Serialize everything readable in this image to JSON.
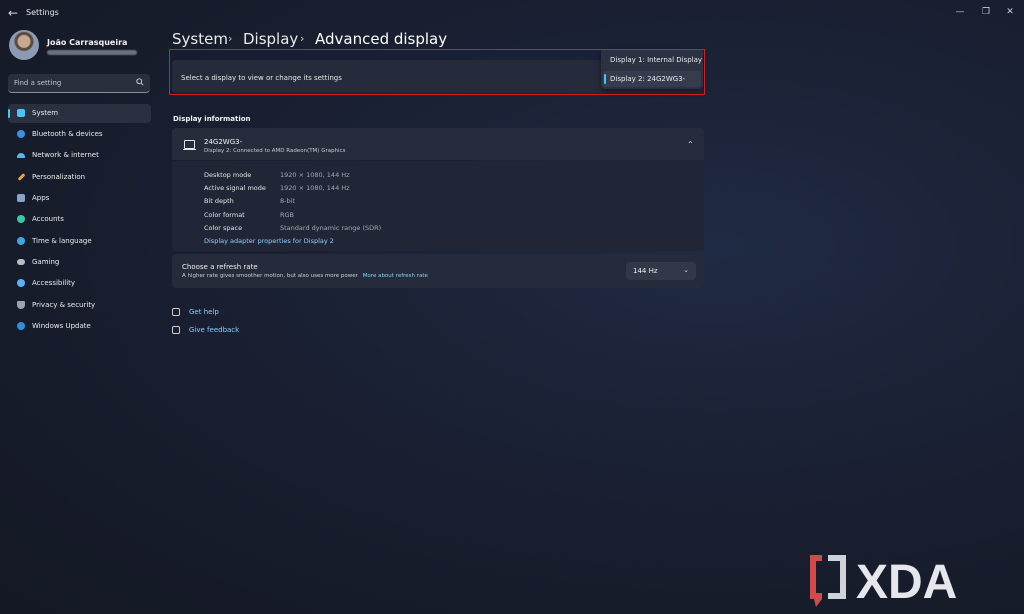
{
  "window": {
    "title": "Settings"
  },
  "profile": {
    "name": "João Carrasqueira"
  },
  "search": {
    "placeholder": "Find a setting"
  },
  "sidebar": {
    "items": [
      {
        "label": "System",
        "icon": "system-icon",
        "color": "#4cc2ff",
        "selected": true
      },
      {
        "label": "Bluetooth & devices",
        "icon": "bluetooth-icon",
        "color": "#3a8ee6"
      },
      {
        "label": "Network & internet",
        "icon": "wifi-icon",
        "color": "#5ab4f0"
      },
      {
        "label": "Personalization",
        "icon": "brush-icon",
        "color": "#e2a24b"
      },
      {
        "label": "Apps",
        "icon": "apps-icon",
        "color": "#8aa4c8"
      },
      {
        "label": "Accounts",
        "icon": "person-icon",
        "color": "#41c6a5"
      },
      {
        "label": "Time & language",
        "icon": "globe-icon",
        "color": "#3fa7e0"
      },
      {
        "label": "Gaming",
        "icon": "controller-icon",
        "color": "#b6bcc8"
      },
      {
        "label": "Accessibility",
        "icon": "accessibility-icon",
        "color": "#5fb0f5"
      },
      {
        "label": "Privacy & security",
        "icon": "shield-icon",
        "color": "#9aa3b2"
      },
      {
        "label": "Windows Update",
        "icon": "update-icon",
        "color": "#2e8fe0"
      }
    ]
  },
  "breadcrumb": {
    "items": [
      "System",
      "Display",
      "Advanced display"
    ]
  },
  "display_selector": {
    "label": "Select a display to view or change its settings",
    "options": [
      "Display 1: Internal Display",
      "Display 2: 24G2WG3-"
    ],
    "selected": "Display 2: 24G2WG3-"
  },
  "display_info": {
    "section_title": "Display information",
    "name": "24G2WG3-",
    "subtitle": "Display 2: Connected to AMD Radeon(TM) Graphics",
    "rows": [
      {
        "key": "Desktop mode",
        "value": "1920 × 1080, 144 Hz"
      },
      {
        "key": "Active signal mode",
        "value": "1920 × 1080, 144 Hz"
      },
      {
        "key": "Bit depth",
        "value": "8-bit"
      },
      {
        "key": "Color format",
        "value": "RGB"
      },
      {
        "key": "Color space",
        "value": "Standard dynamic range (SDR)"
      }
    ],
    "adapter_link": "Display adapter properties for Display 2"
  },
  "refresh": {
    "title": "Choose a refresh rate",
    "description": "A higher rate gives smoother motion, but also uses more power",
    "link": "More about refresh rate",
    "value": "144 Hz"
  },
  "help": {
    "get_help": "Get help",
    "give_feedback": "Give feedback"
  },
  "watermark": {
    "text": "XDA"
  },
  "colors": {
    "accent": "#4cc2ff",
    "highlight_frame": "#d21f1f",
    "link": "#8bd1ff"
  }
}
